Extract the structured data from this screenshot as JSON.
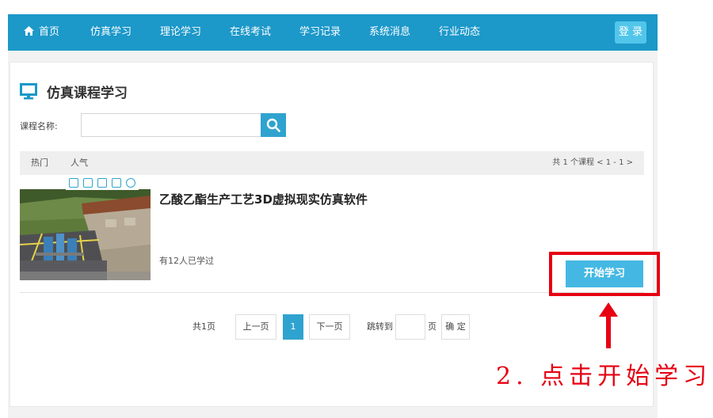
{
  "nav": {
    "items": [
      "首页",
      "仿真学习",
      "理论学习",
      "在线考试",
      "学习记录",
      "系统消息",
      "行业动态"
    ],
    "login": "登 录"
  },
  "section": {
    "title": "仿真课程学习"
  },
  "search": {
    "label": "课程名称:",
    "value": "",
    "placeholder": ""
  },
  "sort": {
    "hot": "热门",
    "popular": "人气",
    "summary": "共 1 个课程 < 1 - 1 >"
  },
  "course": {
    "title": "乙酸乙酯生产工艺3D虚拟现实仿真软件",
    "learned": "有12人已学过",
    "start": "开始学习"
  },
  "pager": {
    "total": "共1页",
    "prev": "上一页",
    "current": "1",
    "next": "下一页",
    "jump": "跳转到",
    "page_unit": "页",
    "confirm": "确 定"
  },
  "annotation": {
    "text": "2. 点击开始学习"
  },
  "colors": {
    "nav": "#1c98c9",
    "accent": "#2fa3cf",
    "button": "#44b8e3",
    "annotation": "#e60012"
  }
}
